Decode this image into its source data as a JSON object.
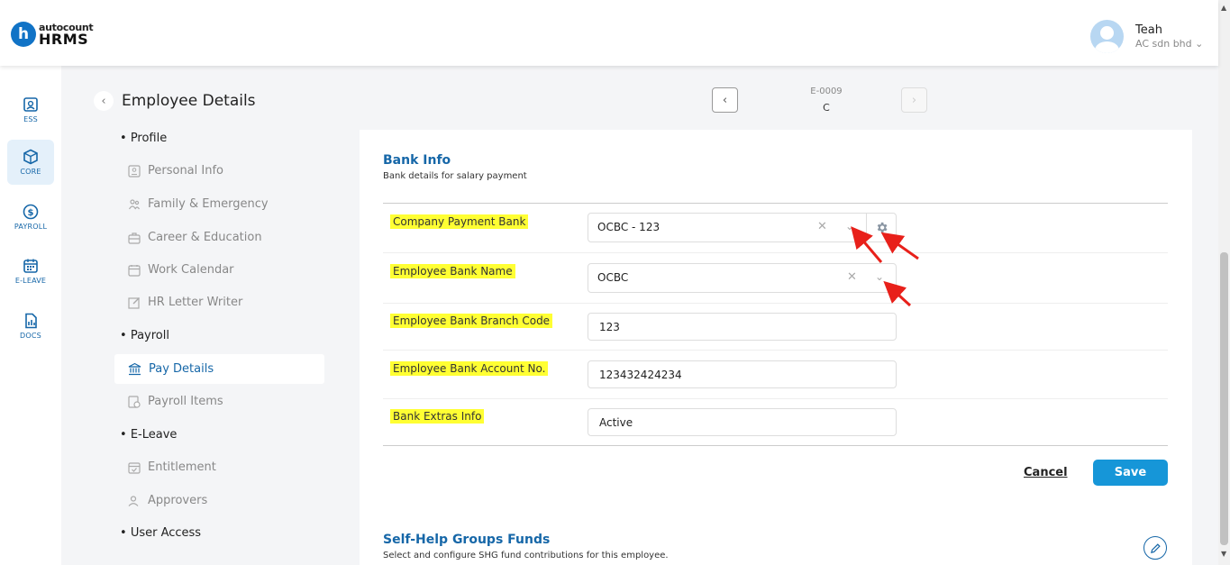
{
  "brand": {
    "logo_letter": "h",
    "logo_top": "autocount",
    "logo_bottom": "HRMS"
  },
  "user": {
    "name": "Teah",
    "company": "AC sdn bhd"
  },
  "leftnav": [
    {
      "label": "ESS",
      "icon": "portrait-icon"
    },
    {
      "label": "CORE",
      "icon": "cube-icon",
      "active": true
    },
    {
      "label": "PAYROLL",
      "icon": "dollar-icon"
    },
    {
      "label": "E-LEAVE",
      "icon": "calendar-icon"
    },
    {
      "label": "DOCS",
      "icon": "document-chart-icon"
    }
  ],
  "page": {
    "title": "Employee Details"
  },
  "record": {
    "code": "E-0009",
    "name": "C"
  },
  "menu": {
    "profile": "Profile",
    "personal_info": "Personal Info",
    "family_emergency": "Family & Emergency",
    "career_education": "Career & Education",
    "work_calendar": "Work Calendar",
    "hr_letter_writer": "HR Letter Writer",
    "payroll": "Payroll",
    "pay_details": "Pay Details",
    "payroll_items": "Payroll Items",
    "eleave": "E-Leave",
    "entitlement": "Entitlement",
    "approvers": "Approvers",
    "user_access": "User Access"
  },
  "bank_info": {
    "title": "Bank Info",
    "subtitle": "Bank details for salary payment",
    "company_payment_bank": {
      "label": "Company Payment Bank",
      "value": "OCBC - 123"
    },
    "employee_bank_name": {
      "label": "Employee Bank Name",
      "value": "OCBC"
    },
    "branch_code": {
      "label": "Employee Bank Branch Code",
      "value": "123"
    },
    "account_no": {
      "label": "Employee Bank Account No.",
      "value": "123432424234"
    },
    "extras_info": {
      "label": "Bank Extras Info",
      "value": "Active"
    },
    "cancel_label": "Cancel",
    "save_label": "Save"
  },
  "shg": {
    "title": "Self-Help Groups Funds",
    "subtitle": "Select and configure SHG fund contributions for this employee."
  },
  "colors": {
    "primary": "#1667a8",
    "accent": "#1696d8",
    "highlight": "#ffff33",
    "annotation": "#e8201a"
  }
}
